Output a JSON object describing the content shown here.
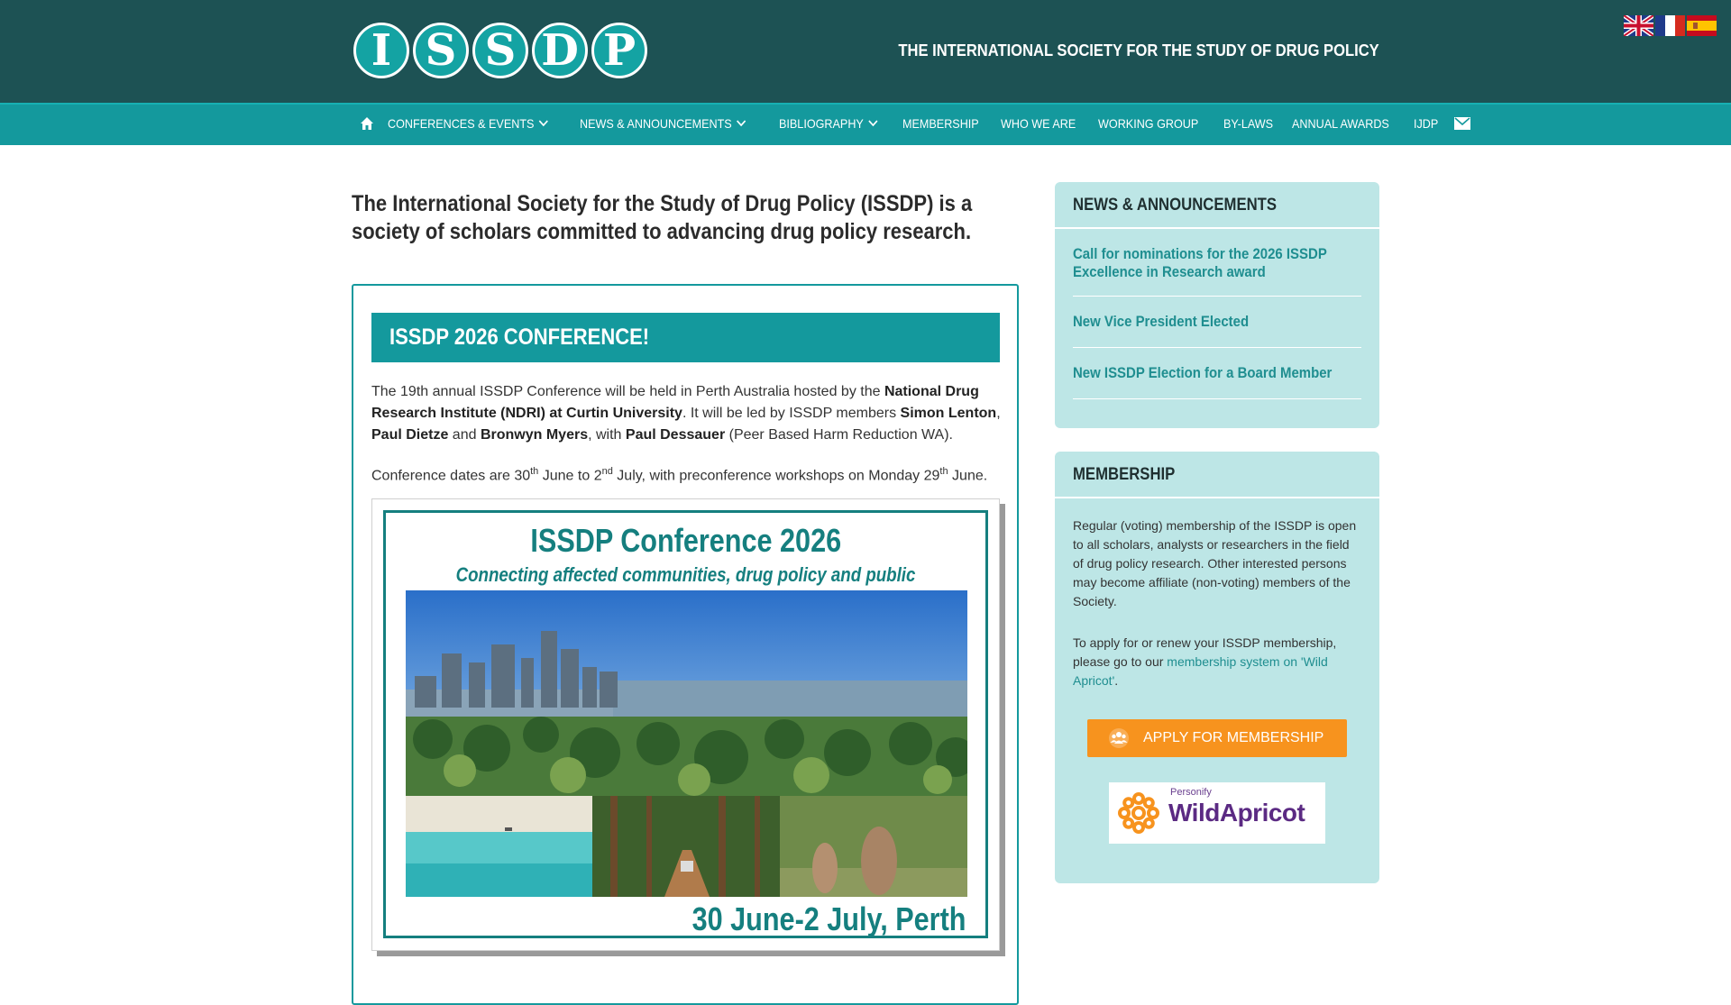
{
  "header": {
    "logo_letters": [
      "I",
      "S",
      "S",
      "D",
      "P"
    ],
    "tagline": "THE INTERNATIONAL SOCIETY FOR THE STUDY OF DRUG POLICY",
    "flags": [
      "english-flag-icon",
      "french-flag-icon",
      "spanish-flag-icon"
    ]
  },
  "nav": {
    "items": [
      {
        "label": "CONFERENCES & EVENTS",
        "dropdown": true
      },
      {
        "label": "NEWS & ANNOUNCEMENTS",
        "dropdown": true
      },
      {
        "label": "BIBLIOGRAPHY",
        "dropdown": true
      },
      {
        "label": "MEMBERSHIP",
        "dropdown": false
      },
      {
        "label": "WHO WE ARE",
        "dropdown": false
      },
      {
        "label": "WORKING GROUP",
        "dropdown": false
      },
      {
        "label": "BY-LAWS",
        "dropdown": false
      },
      {
        "label": "ANNUAL AWARDS",
        "dropdown": false
      },
      {
        "label": "IJDP",
        "dropdown": false
      }
    ]
  },
  "main": {
    "intro": "The International Society for the Study of Drug Policy (ISSDP) is a society of scholars committed to advancing drug policy research.",
    "banner": "ISSDP 2026 CONFERENCE!",
    "p1": {
      "t1": "The 19th annual ISSDP Conference will be held in Perth Australia hosted by the ",
      "b1": "National Drug Research Institute (NDRI) at Curtin University",
      "t2": ". It will be led by ISSDP members ",
      "b2": "Simon Lenton",
      "t3": ", ",
      "b3": "Paul Dietze",
      "t4": " and ",
      "b4": "Bronwyn Myers",
      "t5": ", with ",
      "b5": "Paul Dessauer",
      "t6": " (Peer Based Harm Reduction WA)."
    },
    "p2": {
      "t1": "Conference dates are 30",
      "s1": "th",
      "t2": " June to 2",
      "s2": "nd",
      "t3": " July, with preconference workshops on Monday 29",
      "s3": "th",
      "t4": " June."
    },
    "poster": {
      "title": "ISSDP Conference 2026",
      "subtitle": "Connecting affected communities, drug policy and public health",
      "date": "30 June-2 July, Perth"
    }
  },
  "sidebar": {
    "news": {
      "heading": "NEWS & ANNOUNCEMENTS",
      "items": [
        "Call for nominations for the 2026 ISSDP Excellence in Research award",
        "New Vice President Elected",
        "New ISSDP Election for a Board Member"
      ]
    },
    "membership": {
      "heading": "MEMBERSHIP",
      "para1": "Regular (voting) membership of the ISSDP is open to all scholars, analysts or researchers in the field of drug policy research. Other interested persons may become affiliate (non-voting) members of the Society.",
      "para2_before": "To apply for or renew your ISSDP membership, please go to our ",
      "para2_link": "membership system on 'Wild Apricot'",
      "para2_after": ".",
      "button": "APPLY FOR MEMBERSHIP",
      "partner_small": "Personify",
      "partner_big": "WildApricot"
    }
  },
  "colors": {
    "header_bg": "#1d5254",
    "nav_bg": "#14999d",
    "accent": "#14999d",
    "sidebar_bg": "#bde6e6",
    "button_orange": "#f7931e"
  }
}
